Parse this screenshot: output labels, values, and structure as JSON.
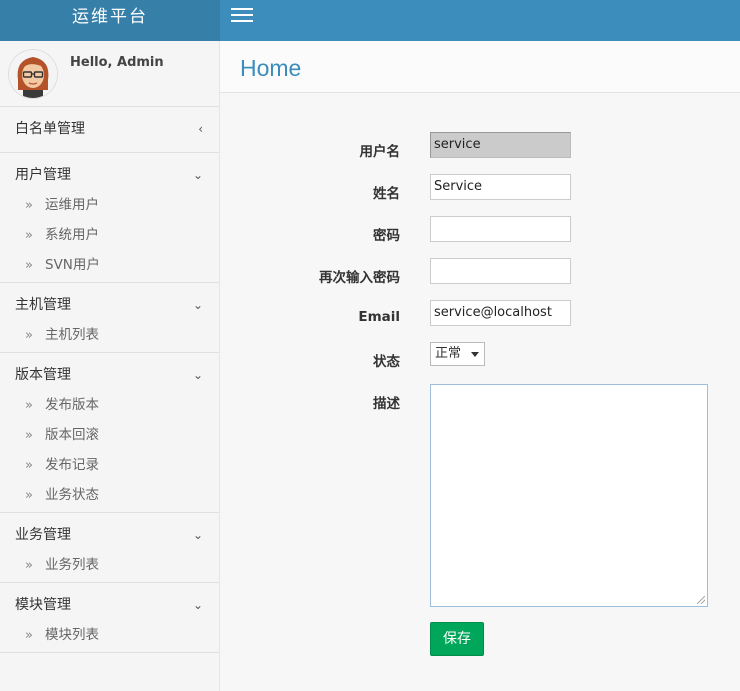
{
  "app": {
    "title": "运维平台"
  },
  "user": {
    "greeting": "Hello, Admin"
  },
  "sidebar": {
    "groups": [
      {
        "label": "白名单管理",
        "chevron": "‹",
        "items": []
      },
      {
        "label": "用户管理",
        "chevron": "⌄",
        "items": [
          "运维用户",
          "系统用户",
          "SVN用户"
        ]
      },
      {
        "label": "主机管理",
        "chevron": "⌄",
        "items": [
          "主机列表"
        ]
      },
      {
        "label": "版本管理",
        "chevron": "⌄",
        "items": [
          "发布版本",
          "版本回滚",
          "发布记录",
          "业务状态"
        ]
      },
      {
        "label": "业务管理",
        "chevron": "⌄",
        "items": [
          "业务列表"
        ]
      },
      {
        "label": "模块管理",
        "chevron": "⌄",
        "items": [
          "模块列表"
        ]
      }
    ],
    "item_bullet": "»"
  },
  "page": {
    "title": "Home"
  },
  "form": {
    "username_label": "用户名",
    "username_value": "service",
    "name_label": "姓名",
    "name_value": "Service",
    "password_label": "密码",
    "password_value": "",
    "password_confirm_label": "再次输入密码",
    "password_confirm_value": "",
    "email_label": "Email",
    "email_value": "service@localhost",
    "status_label": "状态",
    "status_value": "正常",
    "description_label": "描述",
    "description_value": "",
    "save_label": "保存"
  },
  "colors": {
    "topbar": "#3c8dbc",
    "brand": "#367fa9",
    "save": "#00a65a",
    "title": "#3c8dbc"
  }
}
